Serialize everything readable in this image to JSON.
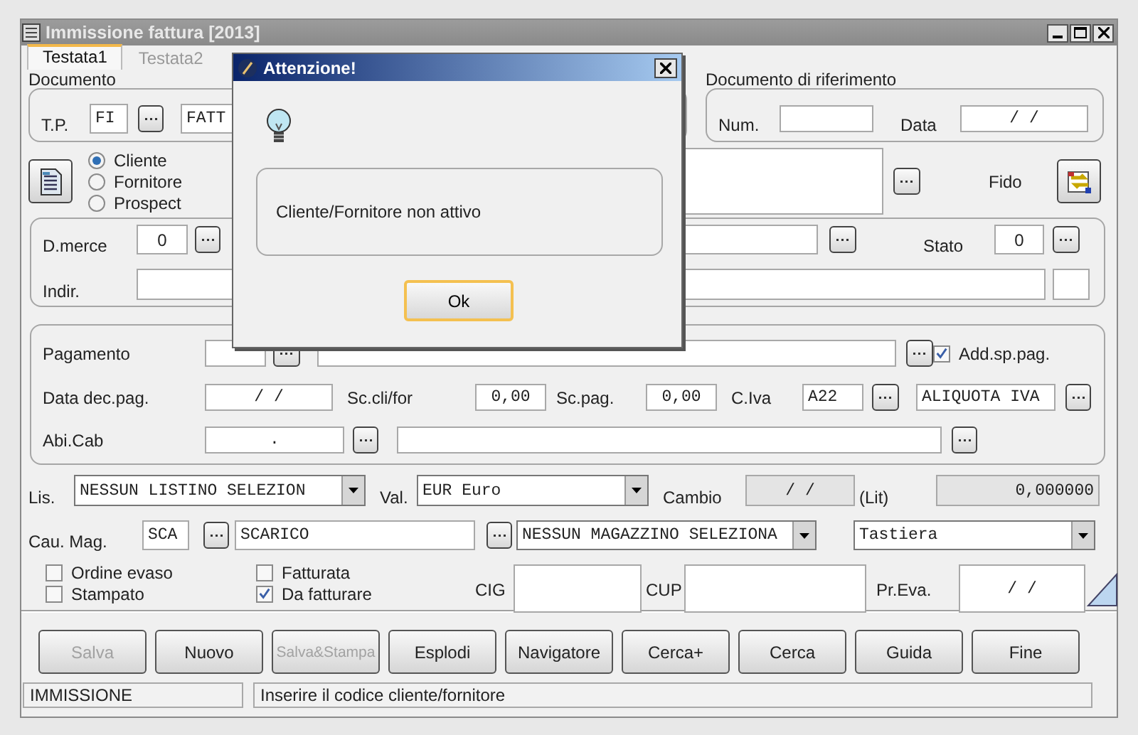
{
  "window": {
    "title": "Immissione fattura [2013]"
  },
  "tabs": [
    {
      "label": "Testata1",
      "selected": true
    },
    {
      "label": "Testata2",
      "selected": false
    }
  ],
  "documento": {
    "label": "Documento",
    "tp_label": "T.P.",
    "tp_code": "FI",
    "tp_desc": "FATT"
  },
  "riferimento": {
    "label": "Documento di riferimento",
    "num_label": "Num.",
    "data_label": "Data",
    "data": "/  /"
  },
  "soggetto": [
    {
      "label": "Cliente",
      "selected": true
    },
    {
      "label": "Fornitore",
      "selected": false
    },
    {
      "label": "Prospect",
      "selected": false
    }
  ],
  "fido_label": "Fido",
  "destinazione": {
    "d_merce_label": "D.merce",
    "d_merce": "0",
    "stato_label": "Stato",
    "stato": "0",
    "indir_label": "Indir."
  },
  "pagamento": {
    "pagamento_label": "Pagamento",
    "add_sp_pag": {
      "label": "Add.sp.pag.",
      "checked": true
    },
    "data_dec_label": "Data dec.pag.",
    "data_dec": "/  /",
    "sc_cli_label": "Sc.cli/for",
    "sc_cli": "0,00",
    "sc_pag_label": "Sc.pag.",
    "sc_pag": "0,00",
    "c_iva_label": "C.Iva",
    "c_iva": "A22",
    "c_iva_desc": "ALIQUOTA IVA",
    "abi_label": "Abi.Cab",
    "abi": "."
  },
  "listino": {
    "lis_label": "Lis.",
    "listino": "NESSUN LISTINO SELEZION",
    "val_label": "Val.",
    "valuta": "EUR  Euro",
    "cambio_label": "Cambio",
    "cambio_data": "/  /",
    "lit_label": "(Lit)",
    "cambio": "0,000000"
  },
  "magazzino": {
    "cau_label": "Cau. Mag.",
    "cau": "SCA",
    "cau_desc": "SCARICO",
    "magazzino": "NESSUN MAGAZZINO SELEZIONA",
    "input": "Tastiera"
  },
  "flags": [
    {
      "label": "Ordine evaso",
      "checked": false
    },
    {
      "label": "Stampato",
      "checked": false
    },
    {
      "label": "Fatturata",
      "checked": false
    },
    {
      "label": "Da fatturare",
      "checked": true
    }
  ],
  "extra": {
    "cig_label": "CIG",
    "cup_label": "CUP",
    "pr_eva_label": "Pr.Eva.",
    "pr_eva": "/  /"
  },
  "buttons": [
    {
      "label": "Salva",
      "disabled": true
    },
    {
      "label": "Nuovo",
      "disabled": false
    },
    {
      "label": "Salva&Stampa",
      "disabled": true
    },
    {
      "label": "Esplodi",
      "disabled": false
    },
    {
      "label": "Navigatore",
      "disabled": false
    },
    {
      "label": "Cerca+",
      "disabled": false
    },
    {
      "label": "Cerca",
      "disabled": false
    },
    {
      "label": "Guida",
      "disabled": false
    },
    {
      "label": "Fine",
      "disabled": false
    }
  ],
  "status_bar": {
    "mode": "IMMISSIONE",
    "message": "Inserire il codice cliente/fornitore"
  },
  "dialog": {
    "title": "Attenzione!",
    "message": "Cliente/Fornitore non attivo",
    "button": "Ok"
  }
}
